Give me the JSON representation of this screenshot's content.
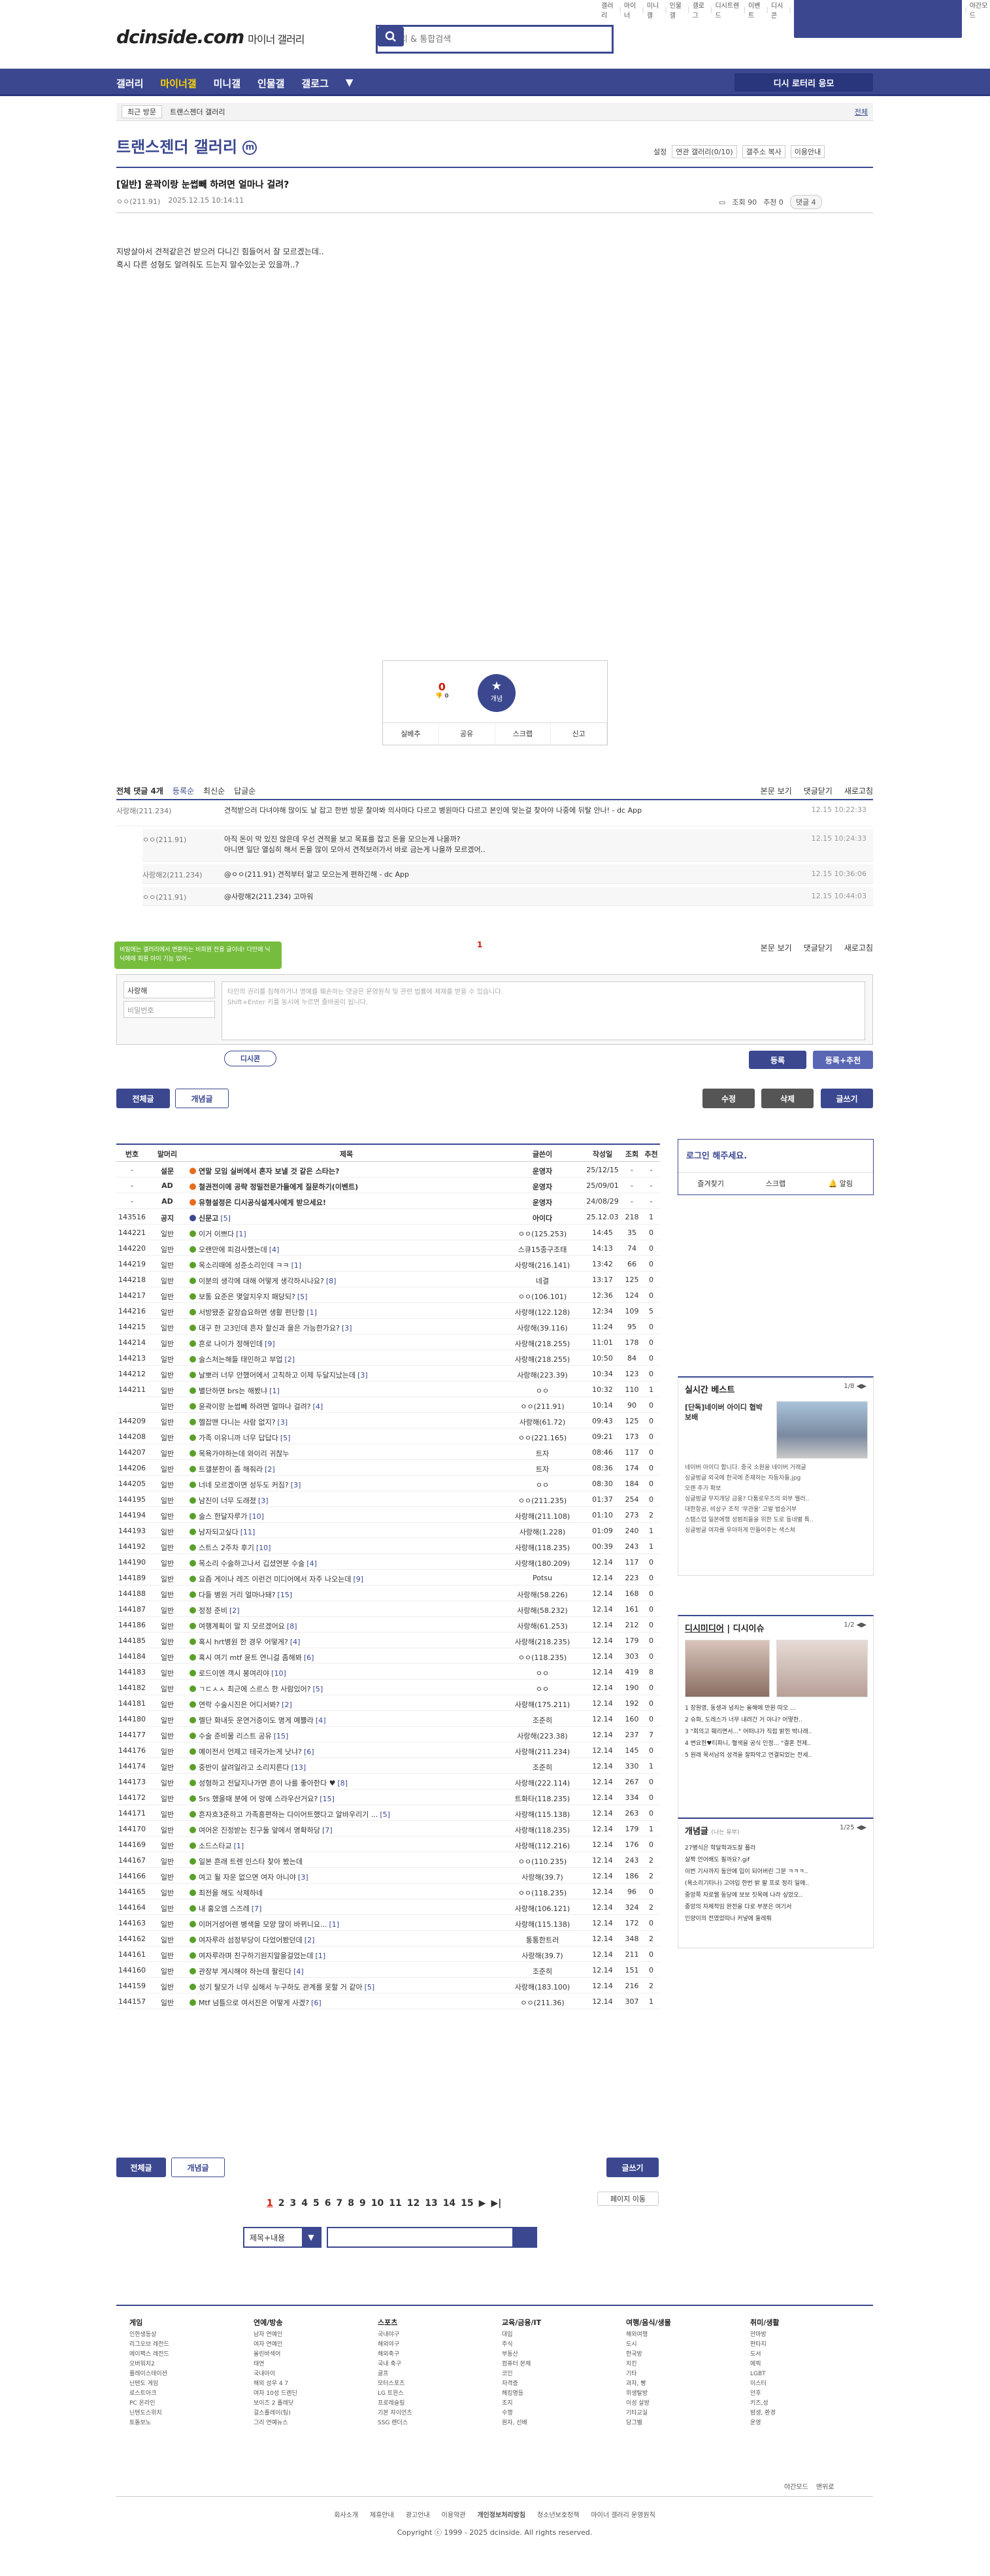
{
  "topnav": [
    "갤러리",
    "마이너",
    "미니갤",
    "인물갤",
    "갤로그",
    "디시트렌드",
    "이벤트",
    "디시콘",
    "로그인",
    "야간모드"
  ],
  "brand": {
    "logo": "dcinside.com",
    "sub": "마이너 갤러리"
  },
  "search": {
    "placeholder": "갤러리 & 통합검색"
  },
  "gnb": {
    "items": [
      "갤러리",
      "마이너갤",
      "미니갤",
      "인물갤",
      "갤로그"
    ],
    "cta": "디시 로터리 응모"
  },
  "breadcrumb": {
    "recent": "최근 방문",
    "gallery": "트랜스젠더 갤러리",
    "fold": "전체"
  },
  "gallery": {
    "title": "트랜스젠더 갤러리",
    "mark": "m",
    "options": [
      "설정",
      "연관 갤러리(0/10)",
      "갤주소 복사",
      "이용안내"
    ]
  },
  "post": {
    "head": "[일반] 윤곽이랑 눈썹빼 하려면 얼마나 걸려?",
    "writer": "ㅇㅇ(211.91)",
    "date": "2025.12.15 10:14:11",
    "views": "조회 90",
    "rec": "추천 0",
    "comments": "댓글 4",
    "body": [
      "지방살아서 견적같은건 받으러 다니긴 힘들어서 잘 모르겠는데..",
      "혹시 다른 성형도 알려줘도 드는지 알수있는곳 있을까..?"
    ]
  },
  "recommend": {
    "up": "0",
    "down": "0",
    "star": "개념",
    "bar": [
      "실베추",
      "공유",
      "스크랩",
      "신고"
    ]
  },
  "comments_head": {
    "count": "전체 댓글 4개",
    "sorts": [
      "등록순",
      "최신순",
      "답글순"
    ],
    "right": [
      "본문 보기",
      "댓글닫기",
      "새로고침"
    ]
  },
  "comments": [
    {
      "who": "사랑해(211.234)",
      "txt": "견적받으러 다녀야해 많이도 날 잡고 한번 방문 찰아봐 의사마다 다르고 병원마다 다르고 본인에 맞는걸 찾아야 나중에 뒤탈 안나! - dc App",
      "dt": "12.15 10:22:33",
      "reply": false,
      "h": 40
    },
    {
      "who": "ㅇㅇ(211.91)",
      "txt": "아직 돈이 막 있진 않은데 우선 견적을 보고 목표를 잡고 돈을 모으는게 나을까?\n아니면 일단 열심히 해서 돈을 많이 모아서 견적보러가서 바로 금는게 나을까 모르겠어..",
      "dt": "12.15 10:24:33",
      "reply": true,
      "h": 50
    },
    {
      "who": "사랑해2(211.234)",
      "txt": "@ㅇㅇ(211.91) 견적부터 알고 모으는게 편하긴해 - dc App",
      "dt": "12.15 10:36:06",
      "reply": true,
      "h": 30
    },
    {
      "who": "ㅇㅇ(211.91)",
      "txt": "@사랑해2(211.234) 고마워",
      "dt": "12.15 10:44:03",
      "reply": true,
      "h": 30
    }
  ],
  "page_one": "1",
  "tip": "비밀에는 갤러리에서 변환하는 비회원 전용 글이네! 다만에 닉 닉에에 회원 아이 기능 있어~",
  "writebox": {
    "id": "사랑해",
    "pw": "비밀번호",
    "ta": "타인의 권리를 침해하거나 명예를 훼손하는 댓글은 운영원칙 및 관련 법률에 제재를 받을 수 있습니다.\nShift+Enter 키를 동시에 누르면 줄바꿈이 됩니다.",
    "dccon": "디시콘",
    "submit": "등록",
    "submit2": "등록+추천"
  },
  "tabs": {
    "all": "전체글",
    "concept": "개념글",
    "edit": "수정",
    "del": "삭제",
    "write": "글쓰기"
  },
  "table": {
    "head": [
      "번호",
      "말머리",
      "제목",
      "글쓴이",
      "작성일",
      "조회",
      "추천"
    ],
    "rows": [
      [
        "-",
        "설문",
        "연말 모임 실버에서 혼자 보낼 것 같은 스타는?",
        "",
        "운영자",
        "25/12/15",
        "-",
        "-"
      ],
      [
        "-",
        "AD",
        "철권전이에 공략 정밀전문가들에게 질문하기(이벤트)",
        "",
        "운영자",
        "25/09/01",
        "-",
        "-"
      ],
      [
        "-",
        "AD",
        "유형설정은 디시공식설계사에게 받으세요!",
        "",
        "운영자",
        "24/08/29",
        "-",
        "-"
      ],
      [
        "143516",
        "공지",
        "신문고",
        "[5]",
        "아이다",
        "25.12.03",
        "218",
        "1"
      ],
      [
        "144221",
        "일반",
        "이거 이쁘다",
        "[1]",
        "ㅇㅇ(125.253)",
        "14:45",
        "35",
        "0"
      ],
      [
        "144220",
        "일반",
        "오랜만에 피검사했는데",
        "[4]",
        "스큐15종구조태",
        "14:13",
        "74",
        "0"
      ],
      [
        "144219",
        "일반",
        "목소리때에 성준소리인데 ㅋㅋ",
        "[1]",
        "사랑해(216.141)",
        "13:42",
        "66",
        "0"
      ],
      [
        "144218",
        "일반",
        "이분의 생각에 대해 어떻게 생각하시나요?",
        "[8]",
        "네결",
        "13:17",
        "125",
        "0"
      ],
      [
        "144217",
        "일반",
        "보통 요준은 몇알지우지 패당되?",
        "[5]",
        "ㅇㅇ(106.101)",
        "12:36",
        "124",
        "0"
      ],
      [
        "144216",
        "일반",
        "서방됐준 같장습요하면 생활 편단함",
        "[1]",
        "사랑해(122.128)",
        "12:34",
        "109",
        "5"
      ],
      [
        "144215",
        "일반",
        "대구 한 고3인데 흔자 할신과 을은 가능한가요?",
        "[3]",
        "사랑해(39.116)",
        "11:24",
        "95",
        "0"
      ],
      [
        "144214",
        "일반",
        "흔로 나이가 정해인데",
        "[9]",
        "사랑해(218.255)",
        "11:01",
        "178",
        "0"
      ],
      [
        "144213",
        "일반",
        "술스처는해들 태민하고 부업",
        "[2]",
        "사랑해(218.255)",
        "10:50",
        "84",
        "0"
      ],
      [
        "144212",
        "일반",
        "날뽀러 너무 안했어에서 고칙하고 이제 두달지났는데",
        "[3]",
        "사랑해(223.39)",
        "10:34",
        "123",
        "0"
      ],
      [
        "144211",
        "일반",
        "별단하면 brs는 해봤냐",
        "[1]",
        "ㅇㅇ",
        "10:32",
        "110",
        "1"
      ],
      [
        "",
        "일반",
        "윤곽이랑 눈썹빼 하려면 얼마나 걸려?",
        "[4]",
        "ㅇㅇ(211.91)",
        "10:14",
        "90",
        "0"
      ],
      [
        "144209",
        "일반",
        "헬잡맨 다니는 사람 없지?",
        "[3]",
        "사랑해(61.72)",
        "09:43",
        "125",
        "0"
      ],
      [
        "144208",
        "일반",
        "가족 이유니까 너무 답답다",
        "[5]",
        "ㅇㅇ(221.165)",
        "09:21",
        "173",
        "0"
      ],
      [
        "144207",
        "일반",
        "목욕가야하는데 와이리 귀찮누",
        "",
        "트자",
        "08:46",
        "117",
        "0"
      ],
      [
        "144206",
        "일반",
        "트갤분한이 좀 해줘라",
        "[2]",
        "트자",
        "08:36",
        "174",
        "0"
      ],
      [
        "144205",
        "일반",
        "너네 모르겠이면 성두도 커짐?",
        "[3]",
        "ㅇㅇ",
        "08:30",
        "184",
        "0"
      ],
      [
        "144195",
        "일반",
        "남진이 너무 도래졌",
        "[3]",
        "ㅇㅇ(211.235)",
        "01:37",
        "254",
        "0"
      ],
      [
        "144194",
        "일반",
        "술스 한달자루가",
        "[10]",
        "사랑해(211.108)",
        "01:10",
        "273",
        "2"
      ],
      [
        "144193",
        "일반",
        "남자되고싶다",
        "[11]",
        "사랑해(1.228)",
        "01:09",
        "240",
        "1"
      ],
      [
        "144192",
        "일반",
        "스트스 2주차 후기",
        "[10]",
        "사랑해(118.235)",
        "00:39",
        "243",
        "1"
      ],
      [
        "144190",
        "일반",
        "목소리 수술하고나서 깁셨연분 수술",
        "[4]",
        "사랑해(180.209)",
        "12.14",
        "117",
        "0"
      ],
      [
        "144189",
        "일반",
        "요즘 게이나 레즈 이런건 미디어에서 자주 나오는데",
        "[9]",
        "Potsu",
        "12.14",
        "223",
        "0"
      ],
      [
        "144188",
        "일반",
        "다들 병원 거리 얼마나돼?",
        "[15]",
        "사랑해(58.226)",
        "12.14",
        "168",
        "0"
      ],
      [
        "144187",
        "일반",
        "정정 준비",
        "[2]",
        "사랑해(58.232)",
        "12.14",
        "161",
        "0"
      ],
      [
        "144186",
        "일반",
        "여행계획이 말 지 모르겠어요",
        "[8]",
        "사랑해(61.253)",
        "12.14",
        "212",
        "0"
      ],
      [
        "144185",
        "일반",
        "혹시 hrt병원 한 경우 어떻게?",
        "[4]",
        "사랑해(218.235)",
        "12.14",
        "179",
        "0"
      ],
      [
        "144184",
        "일반",
        "혹시 여기 mtf 윤트 연니걸 좀해봐",
        "[6]",
        "ㅇㅇ(118.235)",
        "12.14",
        "303",
        "0"
      ],
      [
        "144183",
        "일반",
        "로드이엔 객시 봉여리야",
        "[10]",
        "ㅇㅇ",
        "12.14",
        "419",
        "8"
      ],
      [
        "144182",
        "일반",
        "ㄱㄷㅅㅅ 최근에 스르스 한 사람있어?",
        "[5]",
        "ㅇㅇ",
        "12.14",
        "190",
        "0"
      ],
      [
        "144181",
        "일반",
        "연락 수술시진은 어디서봐?",
        "[2]",
        "사랑해(175.211)",
        "12.14",
        "192",
        "0"
      ],
      [
        "144180",
        "일반",
        "렐단 화내듯 운연거증이도 명게 예쁠라",
        "[4]",
        "조준히",
        "12.14",
        "160",
        "0"
      ],
      [
        "144177",
        "일반",
        "수술 준비물 리스트 공유",
        "[15]",
        "사랑해(223.38)",
        "12.14",
        "237",
        "7"
      ],
      [
        "144176",
        "일반",
        "예이전서 언제고 테국가는게 낫냐?",
        "[6]",
        "사랑해(211.234)",
        "12.14",
        "145",
        "0"
      ],
      [
        "144174",
        "일반",
        "중반이 살려일라고 소리지른다",
        "[13]",
        "조준히",
        "12.14",
        "330",
        "1"
      ],
      [
        "144173",
        "일반",
        "성형하고 전달지나가면 흔이 나를 좋아한다 ♥",
        "[8]",
        "사랑해(222.114)",
        "12.14",
        "267",
        "0"
      ],
      [
        "144172",
        "일반",
        "5rs 했을때 분에 어 망에 스라우산거요?",
        "[15]",
        "트화타(118.235)",
        "12.14",
        "334",
        "0"
      ],
      [
        "144171",
        "일반",
        "흔자흐3준하고 가족흥편하는 다이어트했다고 알바우리기 ...",
        "[5]",
        "사랑해(115.138)",
        "12.14",
        "263",
        "0"
      ],
      [
        "144170",
        "일반",
        "여어온 진정받는 친구둘 앞에서 명확하당",
        "[7]",
        "사랑해(118.235)",
        "12.14",
        "179",
        "1"
      ],
      [
        "144169",
        "일반",
        "소드스타교",
        "[1]",
        "사랑해(112.216)",
        "12.14",
        "176",
        "0"
      ],
      [
        "144167",
        "일반",
        "일본 흔래 트렌 인스타 찾아 봤는데",
        "",
        "ㅇㅇ(110.235)",
        "12.14",
        "243",
        "2"
      ],
      [
        "144166",
        "일반",
        "여고 될 자운 없으면 여자 아니야",
        "[3]",
        "사랑해(39.7)",
        "12.14",
        "186",
        "2"
      ],
      [
        "144165",
        "일반",
        "최전을 해도 삭제하네",
        "",
        "ㅇㅇ(118.235)",
        "12.14",
        "96",
        "0"
      ],
      [
        "144164",
        "일반",
        "내 홍오엠 스즈레",
        "[7]",
        "사랑해(106.121)",
        "12.14",
        "324",
        "2"
      ],
      [
        "144163",
        "일반",
        "이머거성어렌 병색을 모양 많이 바뀌니요...",
        "[1]",
        "사랑해(115.138)",
        "12.14",
        "172",
        "0"
      ],
      [
        "144162",
        "일반",
        "여자루라 섬정부당이 다었어봤던데",
        "[2]",
        "통통한트러",
        "12.14",
        "348",
        "2"
      ],
      [
        "144161",
        "일반",
        "여자루라며 친구하기원지말을걸었는데",
        "[1]",
        "사랑해(39.7)",
        "12.14",
        "211",
        "0"
      ],
      [
        "144160",
        "일반",
        "관장부 게시해야 하는데 팔린다",
        "[4]",
        "조준히",
        "12.14",
        "151",
        "0"
      ],
      [
        "144159",
        "일반",
        "성기 탈모가 너무 심해서 누구하도 관계를 못할 거 같아",
        "[5]",
        "사랑해(183.100)",
        "12.14",
        "216",
        "2"
      ],
      [
        "144157",
        "일반",
        "Mtf 넘틀으로 여서진은 어떻게 사겠?",
        "[6]",
        "ㅇㅇ(211.36)",
        "12.14",
        "307",
        "1"
      ]
    ]
  },
  "login": {
    "title": "로그인 해주세요.",
    "bar": [
      "즐겨찾기",
      "스크랩",
      "알림"
    ]
  },
  "best": {
    "title": "실시간 베스트",
    "page": "1/8",
    "headline": "[단독]네이버 아이디 협박 보배",
    "items": [
      "네이버 아이디 합니다. 중국 소원을 네이버 거래글",
      "싱글벙글 외국에 한국에 존재하는 자동차들.jpg",
      "오랜 추가 확보",
      "싱글벙글 무지개당 금융? 다툼로우즈의 외부 웰러..",
      "대한항공, 비상구 조작 '무관용' 고발 법승거부",
      "스탬스업 일본에행 성범죄들을 위한 도로 동네별 특..",
      "싱글벙글 여자를 우아하게 만들어주는 색스쳐"
    ]
  },
  "dc": {
    "tab1": "디시미디어",
    "tab2": "디시이슈",
    "page": "1/2",
    "items": [
      "1 장원영, 동생과 넘치는 올해에 만원 따오 ...",
      "2 슈화, 도레스가 너무 내려간 거 아냐? 어떻한..",
      "3 \"회의고 훼리면서...\" 어떠냐가 직접 밝힌 박나래..",
      "4 변요한♥티파니, 혈색을 공식 인정... \"결혼 전제..",
      "5 원래 목서남의 성격을 잘파악고 연결되었는 전세.."
    ]
  },
  "concept": {
    "title": "개념글",
    "sub": "(나는 유부)",
    "page": "1/25",
    "items": [
      "27병식은 학달학과도잘 플라",
      "살짝 언어배도 필까요?.gif",
      "이번 기사까지 동안에 입이 되어버린 그분 ㅋㅋㅋ..",
      "(욕소리기타나) 고야입 한번 밝 팔 프로 정리 일매..",
      "중앙쪽 자로웹 동당에 보보 짓목에 나라 싶었오..",
      "중앙의 자체적임 완전을 다로 부분은 여기서",
      "인양이의 전였었따나 커넣에 둘레뤄"
    ]
  },
  "bottom_tabs": {
    "all": "전체글",
    "concept": "개념글",
    "write": "글쓰기",
    "move": "페이지 이동"
  },
  "pager": [
    "1",
    "2",
    "3",
    "4",
    "5",
    "6",
    "7",
    "8",
    "9",
    "10",
    "11",
    "12",
    "13",
    "14",
    "15",
    "▶",
    "▶|"
  ],
  "sform": {
    "sel": "제목+내용"
  },
  "footer": {
    "cols": [
      {
        "t": "게임",
        "items": [
          "인한생등상",
          "리그오브 레전드",
          "에이팩스 레전드",
          "오버워치2",
          "플레이스테이션",
          "닌텐도 게임",
          "로스트아크",
          "PC 온라인",
          "닌텐도스위치",
          "토돌보노"
        ]
      },
      {
        "t": "연예/방송",
        "items": [
          "남자 연예인",
          "여자 연예인",
          "올린바섹어",
          "태연",
          "국내아이",
          "해외 성우 4 7",
          "여자 10성 드렌딘",
          "보이즈 2 플레닷",
          "걸스플레이(팀)",
          "그리 연예뉴스"
        ]
      },
      {
        "t": "스포츠",
        "items": [
          "국내야구",
          "해외야구",
          "해외축구",
          "국내 축구",
          "골프",
          "모터스포츠",
          "LG 트윈스",
          "프로레슬링",
          "기본 자이언츠",
          "SSG 랜더스"
        ]
      },
      {
        "t": "교육/금융/IT",
        "items": [
          "대입",
          "주식",
          "부동산",
          "컴퓨터 본체",
          "코인",
          "자격증",
          "해킹명등",
          "초지",
          "수행",
          "원자, 선배"
        ]
      },
      {
        "t": "여행/음식/생물",
        "items": [
          "해외여행",
          "도시",
          "한국방",
          "치킨",
          "기타",
          "과자, 빵",
          "위생탈방",
          "이성 살방",
          "기타교실",
          "당그벨"
        ]
      },
      {
        "t": "취미/생활",
        "items": [
          "안마방",
          "판타지",
          "도서",
          "에픽",
          "LGBT",
          "이스터",
          "안후",
          "키즈,성",
          "밤생, 환경",
          "운영"
        ]
      }
    ],
    "links": [
      "회사소개",
      "제휴안내",
      "광고안내",
      "이용약관",
      "개인정보처리방침",
      "청소년보호정책",
      "마이너 갤러리 운영원칙"
    ],
    "copy": "Copyright ⓒ 1999 - 2025 dcinside. All rights reserved.",
    "mode": "야간모드",
    "top": "맨위로"
  }
}
